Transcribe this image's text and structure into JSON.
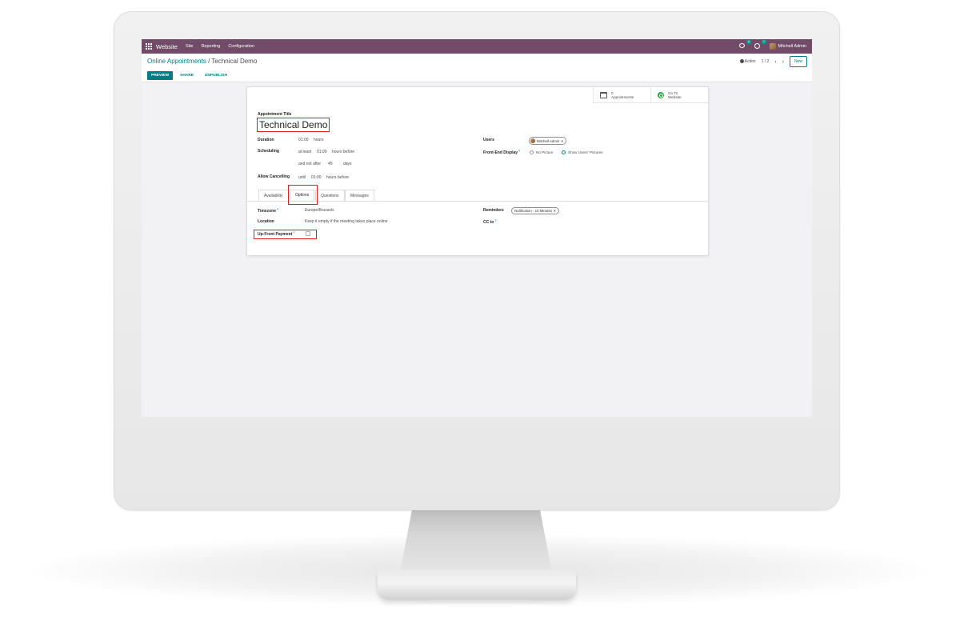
{
  "navbar": {
    "app_name": "Website",
    "menus": [
      "Site",
      "Reporting",
      "Configuration"
    ],
    "chat_count": "4",
    "activity_count": "7",
    "user_name": "Mitchell Admin",
    "color": "#714b67"
  },
  "breadcrumb": {
    "parent": "Online Appointments",
    "separator": "/",
    "current": "Technical Demo"
  },
  "control": {
    "action_label": "Action",
    "pager": "1 / 2",
    "prev_icon": "chevron-left-icon",
    "next_icon": "chevron-right-icon",
    "new_label": "New",
    "buttons": {
      "preview": "PREVIEW",
      "share": "SHARE",
      "unpublish": "UNPUBLISH"
    }
  },
  "stat_buttons": {
    "appointments_count": "0",
    "appointments_label": "Appointments",
    "website_line1": "Go To",
    "website_line2": "Website"
  },
  "form": {
    "title_label": "Appointment Title",
    "title": "Technical Demo",
    "duration": {
      "label": "Duration",
      "value": "01:00",
      "unit": "hours"
    },
    "scheduling": {
      "label": "Scheduling",
      "min_prefix": "at least",
      "min_value": "01:00",
      "min_suffix": "hours before",
      "max_prefix": "and not after",
      "max_value": "45",
      "max_suffix": "days"
    },
    "cancel": {
      "label": "Allow Cancelling",
      "prefix": "until",
      "value": "01:00",
      "suffix": "hours before"
    },
    "users": {
      "label": "Users",
      "tag": "Mitchell Admin"
    },
    "frontend_display": {
      "label": "Front-End Display",
      "options": [
        "No Picture",
        "Show Users' Pictures"
      ],
      "selected": 1
    }
  },
  "tabs": [
    "Availability",
    "Options",
    "Questions",
    "Messages"
  ],
  "active_tab": "Options",
  "options_tab": {
    "timezone": {
      "label": "Timezone",
      "value": "Europe/Brussels"
    },
    "location": {
      "label": "Location",
      "placeholder": "Keep it empty if the meeting takes place online"
    },
    "upfront_payment": {
      "label": "Up-Front Payment",
      "checked": false
    },
    "reminders": {
      "label": "Reminders",
      "tag": "Notification - 15 Minutes"
    },
    "cc_to": {
      "label": "CC to"
    }
  },
  "colors": {
    "brand": "#714b67",
    "accent": "#017e84",
    "highlight": "#e02020"
  }
}
